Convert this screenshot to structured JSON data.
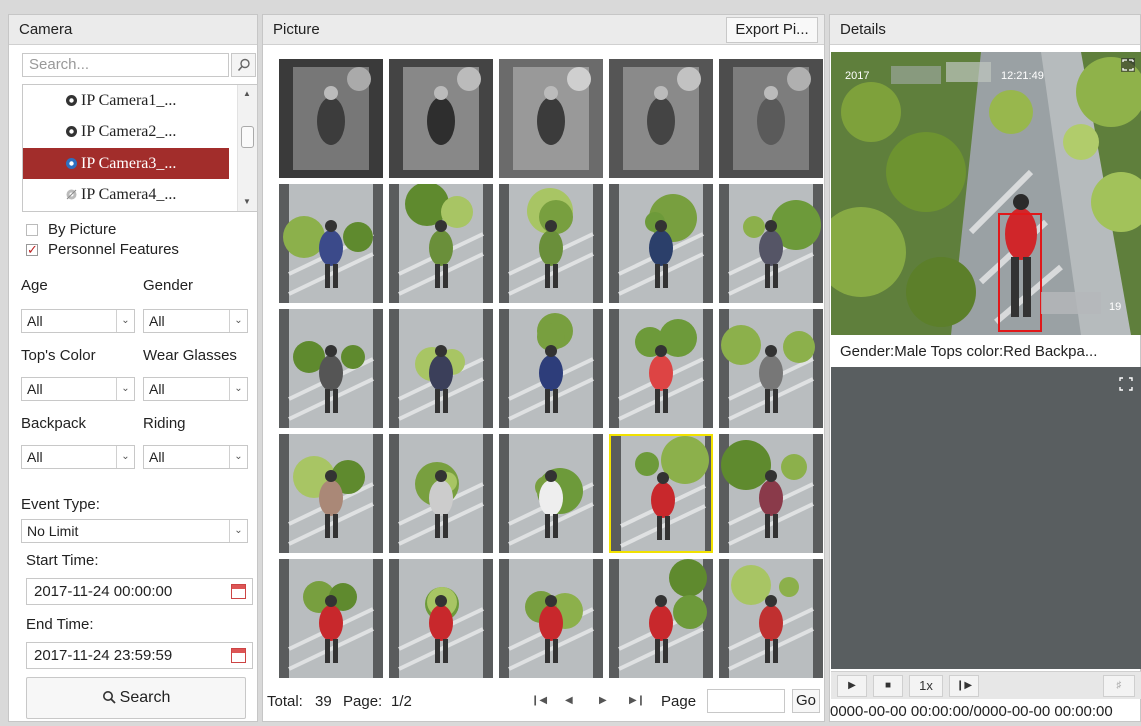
{
  "left": {
    "title": "Camera",
    "search_placeholder": "Search...",
    "cameras": [
      {
        "label": "IP Camera1_...",
        "selected": false,
        "icon": "camera-icon"
      },
      {
        "label": "IP Camera2_...",
        "selected": false,
        "icon": "camera-icon"
      },
      {
        "label": "IP Camera3_...",
        "selected": true,
        "icon": "camera-icon"
      },
      {
        "label": "IP Camera4_...",
        "selected": false,
        "icon": "camera-offline-icon"
      }
    ],
    "by_picture": {
      "label": "By Picture",
      "checked": false
    },
    "personnel_features": {
      "label": "Personnel Features",
      "checked": true
    },
    "age": {
      "label": "Age",
      "value": "All"
    },
    "gender": {
      "label": "Gender",
      "value": "All"
    },
    "tops_color": {
      "label": "Top's Color",
      "value": "All"
    },
    "wear_glasses": {
      "label": "Wear Glasses",
      "value": "All"
    },
    "backpack": {
      "label": "Backpack",
      "value": "All"
    },
    "riding": {
      "label": "Riding",
      "value": "All"
    },
    "event_type": {
      "label": "Event Type:",
      "value": "No Limit"
    },
    "start_time": {
      "label": "Start Time:",
      "value": "2017-11-24 00:00:00"
    },
    "end_time": {
      "label": "End Time:",
      "value": "2017-11-24 23:59:59"
    },
    "search_button": "Search"
  },
  "mid": {
    "title": "Picture",
    "export_button": "Export Pi...",
    "total_label": "Total:",
    "total_value": "39",
    "page_label": "Page:",
    "page_value": "1/2",
    "page_jump_label": "Page",
    "go_button": "Go",
    "selected_index": 18,
    "thumbnail_count": 25
  },
  "right": {
    "title": "Details",
    "overlay_timestamp": "2017",
    "overlay_time": "12:21:49",
    "overlay_corner": "19",
    "attributes": "Gender:Male  Tops color:Red  Backpa...",
    "speed_label": "1x",
    "time_range": "0000-00-00 00:00:00/0000-00-00 00:00:00"
  },
  "colors": {
    "accent_selected": "#a22d2b",
    "thumb_highlight": "#f1e100",
    "detection_box": "#e0181a",
    "player_bg": "#595e60"
  }
}
